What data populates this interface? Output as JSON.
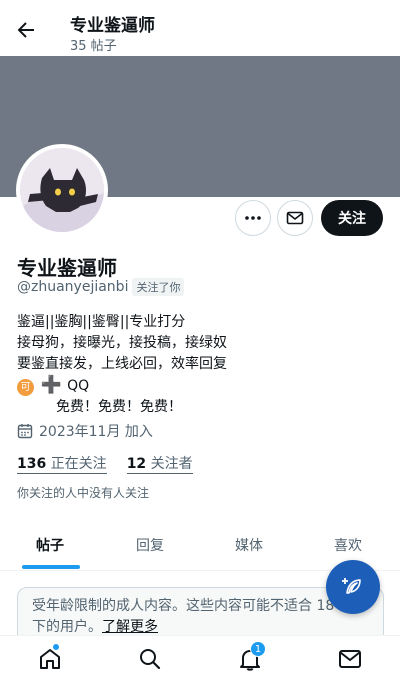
{
  "header": {
    "title": "专业鉴逼师",
    "post_count": "35 帖子"
  },
  "profile": {
    "name": "专业鉴逼师",
    "handle": "@zhuanyejianbi",
    "follows_you": "关注了你",
    "bio_lines": [
      "鉴逼||鉴胸||鉴臀||专业打分",
      "接母狗，接曝光，接投稿，接绿奴",
      "要鉴直接发，上线必回，效率回复"
    ],
    "coin_glyph": "可",
    "contact": "QQ",
    "free_line": "免费！免费！免费！",
    "joined": "2023年11月 加入",
    "following_count": "136",
    "following_label": "正在关注",
    "followers_count": "12",
    "followers_label": "关注者",
    "no_mutuals": "你关注的人中没有人关注"
  },
  "actions": {
    "follow_label": "关注"
  },
  "tabs": [
    {
      "label": "帖子",
      "active": true
    },
    {
      "label": "回复",
      "active": false
    },
    {
      "label": "媒体",
      "active": false
    },
    {
      "label": "喜欢",
      "active": false
    }
  ],
  "notice": {
    "text": "受年龄限制的成人内容。这些内容可能不适合 18 岁以下的用户。",
    "link": "了解更多"
  },
  "bottom_nav": {
    "notification_badge": "1"
  },
  "colors": {
    "banner": "#6f7884",
    "accent": "#1d9bf0",
    "fab": "#1d5fb8",
    "follow_button": "#0f1419"
  }
}
